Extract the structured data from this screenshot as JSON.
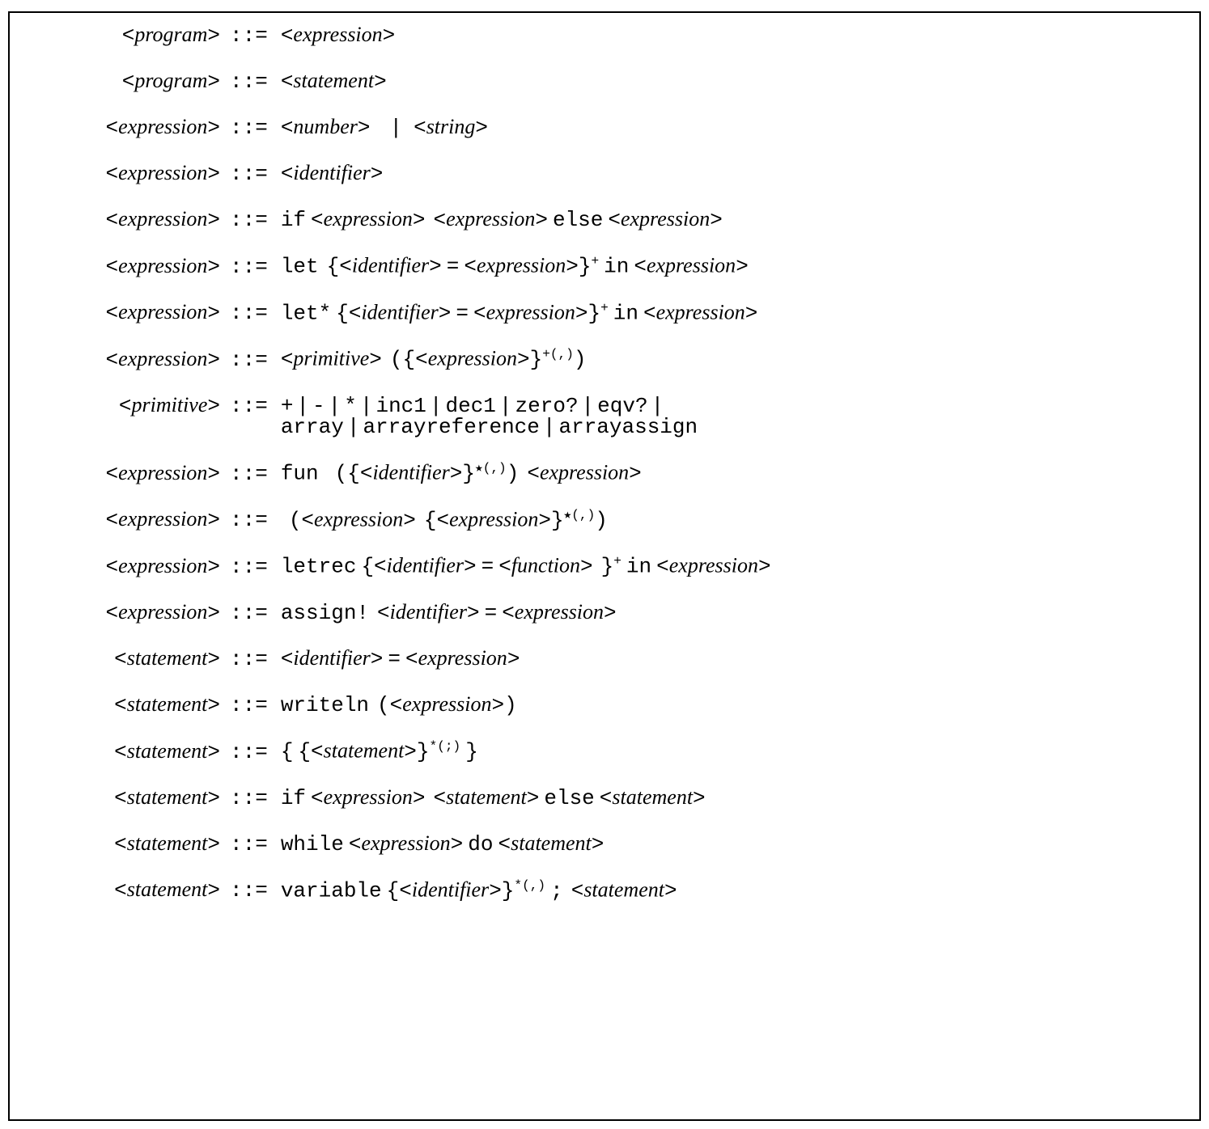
{
  "token": {
    "defined_as": "::=",
    "bar": "|",
    "lt": "<",
    "gt": ">",
    "lb": "{",
    "rb": "}",
    "lp": "(",
    "rp": ")",
    "eq_sign": "=",
    "semi": ";",
    "sup_plus": "+",
    "sup_star": "*",
    "sup_star_solid": "★",
    "sup_comma": "(,)",
    "sup_semi": "(;)"
  },
  "nonterm": {
    "program": "program",
    "expression": "expression",
    "statement": "statement",
    "number": "number",
    "string": "string",
    "identifier": "identifier",
    "primitive": "primitive",
    "function": "function"
  },
  "kw": {
    "if": "if",
    "else": "else",
    "let": "let",
    "let_star": "let*",
    "in": "in",
    "fun": "fun",
    "letrec": "letrec",
    "assign_bang": "assign!",
    "writeln": "writeln",
    "while": "while",
    "do": "do",
    "variable": "variable",
    "plus": "+",
    "minus": "-",
    "times": "*",
    "inc1": "inc1",
    "dec1": "dec1",
    "zeroq": "zero?",
    "eqvq": "eqv?",
    "array": "array",
    "arrayreference": "arrayreference",
    "arrayassign": "arrayassign"
  },
  "grammar_rules": [
    {
      "lhs": "program",
      "rhs": "<expression>"
    },
    {
      "lhs": "program",
      "rhs": "<statement>"
    },
    {
      "lhs": "expression",
      "rhs": "<number> | <string>"
    },
    {
      "lhs": "expression",
      "rhs": "<identifier>"
    },
    {
      "lhs": "expression",
      "rhs": "if <expression> <expression> else <expression>"
    },
    {
      "lhs": "expression",
      "rhs": "let {<identifier> = <expression>}+ in <expression>"
    },
    {
      "lhs": "expression",
      "rhs": "let* {<identifier> = <expression>}+ in <expression>"
    },
    {
      "lhs": "expression",
      "rhs": "<primitive> ({<expression>}+(,))"
    },
    {
      "lhs": "primitive",
      "rhs": "+ | - | * | inc1 | dec1 | zero? | eqv? | array | arrayreference | arrayassign"
    },
    {
      "lhs": "expression",
      "rhs": "fun ({<identifier>}*(,)) <expression>"
    },
    {
      "lhs": "expression",
      "rhs": "(<expression> {<expression>}*(,))"
    },
    {
      "lhs": "expression",
      "rhs": "letrec {<identifier> = <function> }+ in <expression>"
    },
    {
      "lhs": "expression",
      "rhs": "assign! <identifier> = <expression>"
    },
    {
      "lhs": "statement",
      "rhs": "<identifier> = <expression>"
    },
    {
      "lhs": "statement",
      "rhs": "writeln (<expression>)"
    },
    {
      "lhs": "statement",
      "rhs": "{ {<statement>}*(;) }"
    },
    {
      "lhs": "statement",
      "rhs": "if <expression> <statement> else <statement>"
    },
    {
      "lhs": "statement",
      "rhs": "while <expression> do <statement>"
    },
    {
      "lhs": "statement",
      "rhs": "variable {<identifier>}*(,) ; <statement>"
    }
  ]
}
